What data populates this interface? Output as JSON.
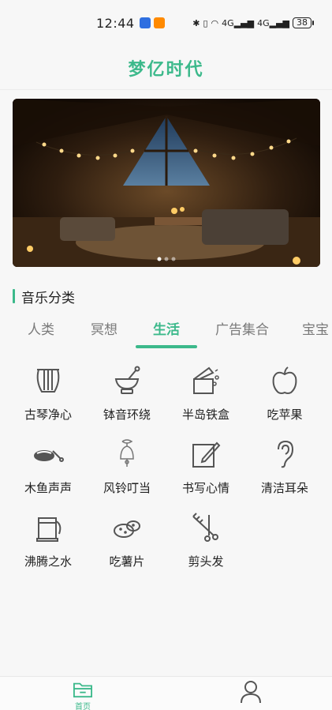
{
  "status_bar": {
    "time": "12:44",
    "network_1": "4G",
    "network_2": "4G",
    "battery": "38"
  },
  "header": {
    "title": "梦亿时代"
  },
  "banner": {
    "description": "",
    "indicator_dots": 3,
    "active_dot": 0
  },
  "section": {
    "title": "音乐分类"
  },
  "tabs": [
    {
      "label": "人类"
    },
    {
      "label": "冥想"
    },
    {
      "label": "生活"
    },
    {
      "label": "广告集合"
    },
    {
      "label": "宝宝"
    }
  ],
  "active_tab": 2,
  "items": [
    {
      "label": "古琴净心",
      "icon": "lyre-icon"
    },
    {
      "label": "钵音环绕",
      "icon": "mortar-bowl-icon"
    },
    {
      "label": "半岛铁盒",
      "icon": "music-box-icon"
    },
    {
      "label": "吃苹果",
      "icon": "apple-icon"
    },
    {
      "label": "木鱼声声",
      "icon": "wooden-fish-icon"
    },
    {
      "label": "风铃叮当",
      "icon": "wind-chime-icon"
    },
    {
      "label": "书写心情",
      "icon": "pen-paper-icon"
    },
    {
      "label": "清洁耳朵",
      "icon": "ear-icon"
    },
    {
      "label": "沸腾之水",
      "icon": "kettle-icon"
    },
    {
      "label": "吃薯片",
      "icon": "potato-icon"
    },
    {
      "label": "剪头发",
      "icon": "scissors-comb-icon"
    }
  ],
  "bottom_nav": [
    {
      "label": "首页",
      "icon": "folder-icon",
      "active": true
    },
    {
      "label": "我的",
      "icon": "user-icon",
      "active": false
    }
  ],
  "colors": {
    "accent": "#3cb98b",
    "text": "#222222",
    "muted": "#7a7a7a",
    "background": "#f7f7f7"
  }
}
